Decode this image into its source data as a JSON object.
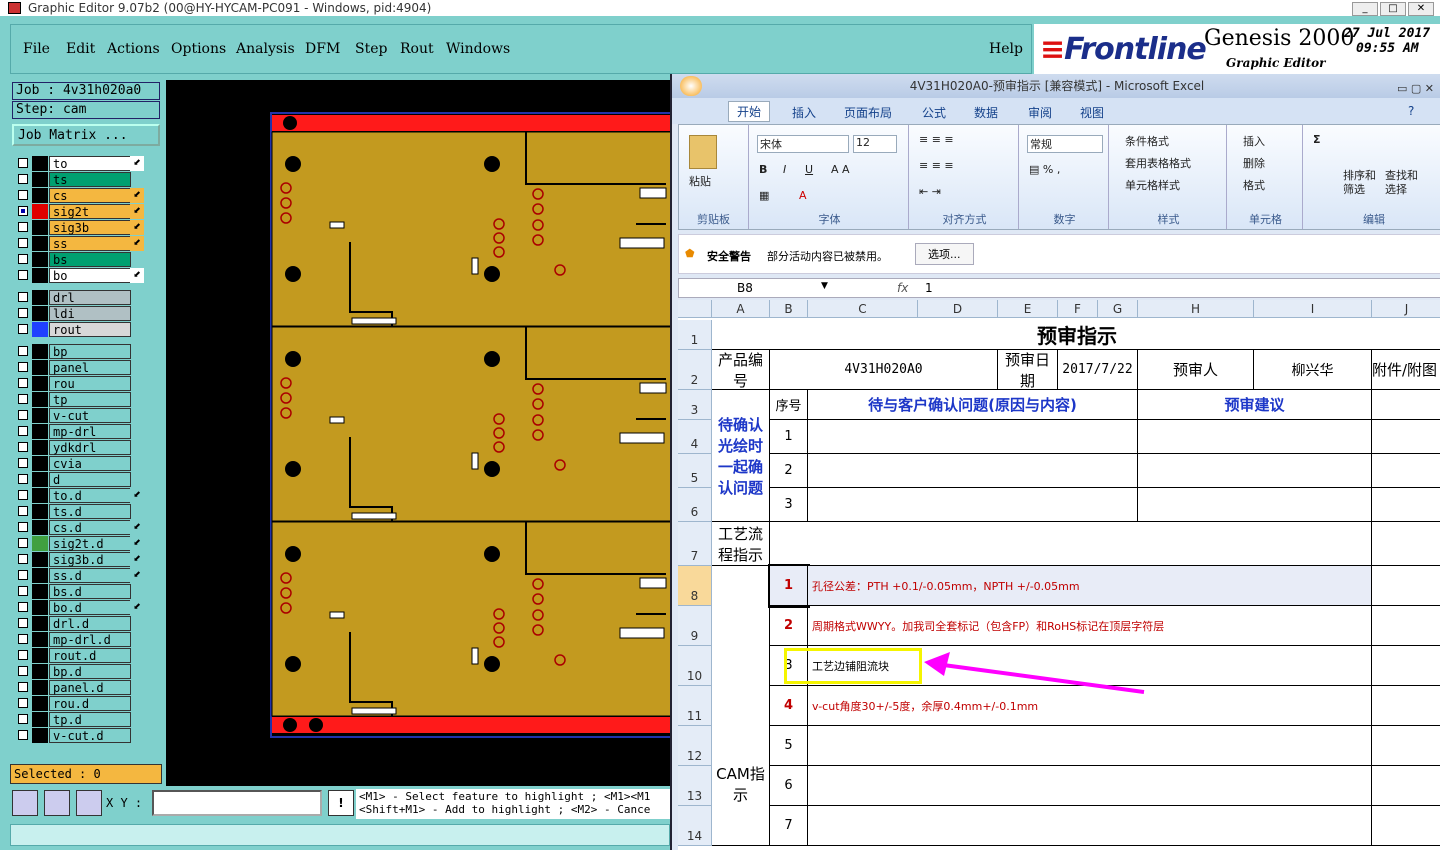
{
  "genesis": {
    "title": "Graphic Editor 9.07b2 (00@HY-HYCAM-PC091 - Windows, pid:4904)",
    "menu": [
      "File",
      "Edit",
      "Actions",
      "Options",
      "Analysis",
      "DFM",
      "Step",
      "Rout",
      "Windows"
    ],
    "help": "Help",
    "brand": {
      "logo": "Frontline",
      "product": "Genesis 2000",
      "subtitle": "Graphic Editor",
      "date": "27 Jul 2017",
      "time": "09:55 AM"
    },
    "job": "Job : 4v31h020a0",
    "step": "Step: cam",
    "job_matrix": "Job Matrix ...",
    "layers": [
      {
        "name": "to",
        "bg": "#ffffff",
        "swatch": "#000000",
        "arrow": true
      },
      {
        "name": "ts",
        "bg": "#00a070",
        "swatch": "#000000",
        "arrow": false
      },
      {
        "name": "cs",
        "bg": "#f4b740",
        "swatch": "#000000",
        "arrow": true
      },
      {
        "name": "sig2t",
        "bg": "#f4b740",
        "swatch": "#e00000",
        "arrow": true,
        "selected": true
      },
      {
        "name": "sig3b",
        "bg": "#f4b740",
        "swatch": "#000000",
        "arrow": true
      },
      {
        "name": "ss",
        "bg": "#f4b740",
        "swatch": "#000000",
        "arrow": true
      },
      {
        "name": "bs",
        "bg": "#00a070",
        "swatch": "#000000",
        "arrow": false
      },
      {
        "name": "bo",
        "bg": "#ffffff",
        "swatch": "#000000",
        "arrow": true
      },
      {
        "name": "drl",
        "bg": "#b0c0c4",
        "swatch": "#000000",
        "arrow": false
      },
      {
        "name": "ldi",
        "bg": "#b0c0c4",
        "swatch": "#000000",
        "arrow": false
      },
      {
        "name": "rout",
        "bg": "#d8d8d8",
        "swatch": "#2040ff",
        "arrow": false
      },
      {
        "name": "bp",
        "bg": "#7fd0cc",
        "swatch": "#000000",
        "arrow": false
      },
      {
        "name": "panel",
        "bg": "#7fd0cc",
        "swatch": "#000000",
        "arrow": false
      },
      {
        "name": "rou",
        "bg": "#7fd0cc",
        "swatch": "#000000",
        "arrow": false
      },
      {
        "name": "tp",
        "bg": "#7fd0cc",
        "swatch": "#000000",
        "arrow": false
      },
      {
        "name": "v-cut",
        "bg": "#7fd0cc",
        "swatch": "#000000",
        "arrow": false
      },
      {
        "name": "mp-drl",
        "bg": "#7fd0cc",
        "swatch": "#000000",
        "arrow": false
      },
      {
        "name": "ydkdrl",
        "bg": "#7fd0cc",
        "swatch": "#000000",
        "arrow": false
      },
      {
        "name": "cvia",
        "bg": "#7fd0cc",
        "swatch": "#000000",
        "arrow": false
      },
      {
        "name": "d",
        "bg": "#7fd0cc",
        "swatch": "#000000",
        "arrow": false
      },
      {
        "name": "to.d",
        "bg": "#7fd0cc",
        "swatch": "#000000",
        "arrow": true
      },
      {
        "name": "ts.d",
        "bg": "#7fd0cc",
        "swatch": "#000000",
        "arrow": false
      },
      {
        "name": "cs.d",
        "bg": "#7fd0cc",
        "swatch": "#000000",
        "arrow": true
      },
      {
        "name": "sig2t.d",
        "bg": "#7fd0cc",
        "swatch": "#40a040",
        "arrow": true
      },
      {
        "name": "sig3b.d",
        "bg": "#7fd0cc",
        "swatch": "#000000",
        "arrow": true
      },
      {
        "name": "ss.d",
        "bg": "#7fd0cc",
        "swatch": "#000000",
        "arrow": true
      },
      {
        "name": "bs.d",
        "bg": "#7fd0cc",
        "swatch": "#000000",
        "arrow": false
      },
      {
        "name": "bo.d",
        "bg": "#7fd0cc",
        "swatch": "#000000",
        "arrow": true
      },
      {
        "name": "drl.d",
        "bg": "#7fd0cc",
        "swatch": "#000000",
        "arrow": false
      },
      {
        "name": "mp-drl.d",
        "bg": "#7fd0cc",
        "swatch": "#000000",
        "arrow": false
      },
      {
        "name": "rout.d",
        "bg": "#7fd0cc",
        "swatch": "#000000",
        "arrow": false
      },
      {
        "name": "bp.d",
        "bg": "#7fd0cc",
        "swatch": "#000000",
        "arrow": false
      },
      {
        "name": "panel.d",
        "bg": "#7fd0cc",
        "swatch": "#000000",
        "arrow": false
      },
      {
        "name": "rou.d",
        "bg": "#7fd0cc",
        "swatch": "#000000",
        "arrow": false
      },
      {
        "name": "tp.d",
        "bg": "#7fd0cc",
        "swatch": "#000000",
        "arrow": false
      },
      {
        "name": "v-cut.d",
        "bg": "#7fd0cc",
        "swatch": "#000000",
        "arrow": false
      }
    ],
    "selected": "Selected : 0",
    "xy_label": "X Y :",
    "hint_line1": "<M1> - Select feature to highlight ; <M1><M1",
    "hint_line2": "<Shift+M1> - Add to highlight ; <M2> - Cance"
  },
  "excel": {
    "title": "4V31H020A0-预审指示 [兼容模式] - Microsoft Excel",
    "tabs": [
      "开始",
      "插入",
      "页面布局",
      "公式",
      "数据",
      "审阅",
      "视图"
    ],
    "ribbon": {
      "clipboard": {
        "paste": "粘贴",
        "label": "剪贴板"
      },
      "font": {
        "name": "宋体",
        "size": "12",
        "label": "字体"
      },
      "align": {
        "label": "对齐方式"
      },
      "number": {
        "format": "常规",
        "label": "数字"
      },
      "styles": {
        "cond": "条件格式",
        "table": "套用表格格式",
        "cell": "单元格样式",
        "label": "样式"
      },
      "cells": {
        "insert": "插入",
        "delete": "删除",
        "format": "格式",
        "label": "单元格"
      },
      "edit": {
        "sort": "排序和",
        "sort2": "筛选",
        "find": "查找和",
        "find2": "选择",
        "label": "编辑"
      }
    },
    "security": {
      "label": "安全警告",
      "text": "部分活动内容已被禁用。",
      "button": "选项..."
    },
    "namebox": "B8",
    "fx": "fx",
    "formula": "1",
    "columns": [
      "A",
      "B",
      "C",
      "D",
      "E",
      "F",
      "G",
      "H",
      "I",
      "J"
    ],
    "rows": [
      "1",
      "2",
      "3",
      "4",
      "5",
      "6",
      "7",
      "8",
      "9",
      "10",
      "11",
      "12",
      "13",
      "14"
    ],
    "sheet": {
      "title": "预审指示",
      "product_label": "产品编号",
      "product_value": "4V31H020A0",
      "date_label": "预审日期",
      "date_value": "2017/7/22",
      "reviewer_label": "预审人",
      "reviewer_value": "柳兴华",
      "attach_label": "附件/附图",
      "seq_label": "序号",
      "issue_header": "待与客户确认问题(原因与内容)",
      "advice_header": "预审建议",
      "pending_label": "待确认光绘时一起确认问题",
      "pending_seq": [
        "1",
        "2",
        "3"
      ],
      "process_label": "工艺流程指示",
      "cam_label": "CAM指示",
      "cam_items": [
        {
          "seq": "1",
          "text": "孔径公差：PTH +0.1/-0.05mm，NPTH +/-0.05mm",
          "red": true
        },
        {
          "seq": "2",
          "text": "周期格式WWYY。加我司全套标记（包含FP）和RoHS标记在顶层字符层",
          "red": true
        },
        {
          "seq": "3",
          "text": "工艺边铺阻流块",
          "red": false
        },
        {
          "seq": "4",
          "text": "v-cut角度30+/-5度，余厚0.4mm+/-0.1mm",
          "red": true
        },
        {
          "seq": "5",
          "text": "",
          "red": false
        },
        {
          "seq": "6",
          "text": "",
          "red": false
        },
        {
          "seq": "7",
          "text": "",
          "red": false
        }
      ]
    }
  }
}
